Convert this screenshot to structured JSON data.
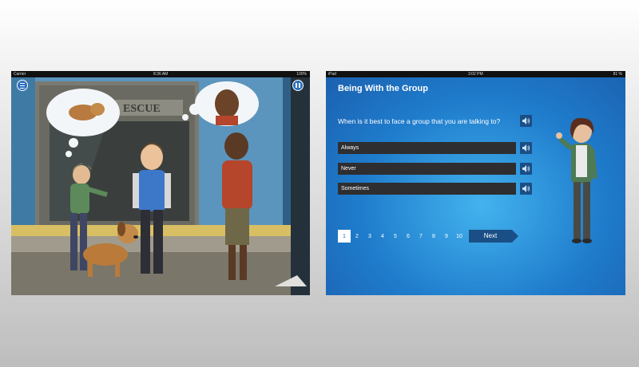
{
  "left_screen": {
    "status": {
      "carrier": "Carrier",
      "time": "8:36 AM",
      "battery": "100%"
    },
    "menu_icon": "menu-icon",
    "pause_icon": "pause-icon",
    "sign_text": "ESCUE"
  },
  "right_screen": {
    "status": {
      "carrier": "iPad",
      "time": "3:02 PM",
      "battery": "81 %"
    },
    "title": "Being With the Group",
    "question": "When is it best to face a group that you are talking to?",
    "answers": [
      "Always",
      "Never",
      "Sometimes"
    ],
    "pages": [
      "1",
      "2",
      "3",
      "4",
      "5",
      "6",
      "7",
      "8",
      "9",
      "10"
    ],
    "current_page": "1",
    "next_label": "Next",
    "speaker_icon": "speaker-icon",
    "colors": {
      "accent": "#1a4f86",
      "answer_bg": "#2e2e30",
      "bg": "#2a8bd8"
    }
  }
}
